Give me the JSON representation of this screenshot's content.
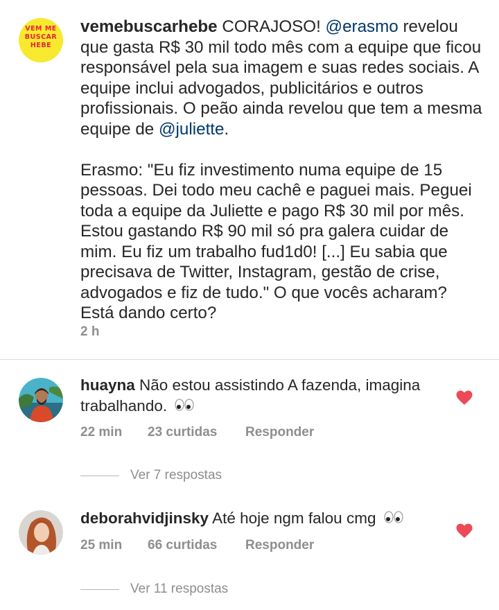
{
  "post": {
    "username": "vemebuscarhebe",
    "logo_text": "VEM ME BUSCAR HEBE",
    "text_part1": " CORAJOSO! ",
    "mention1": "@erasmo",
    "text_part2": " revelou que gasta R$ 30 mil todo mês com a equipe que ficou responsável pela sua imagem e suas redes sociais. A equipe inclui advogados, publicitários e outros profissionais. O peão ainda revelou que tem a mesma equipe de ",
    "mention2": "@juliette",
    "text_part3": ".\n\nErasmo: \"Eu fiz investimento numa equipe de 15 pessoas. Dei todo meu cachê e paguei mais. Peguei toda a equipe da Juliette e pago R$ 30 mil por mês. Estou gastando R$ 90 mil só pra galera cuidar de mim. Eu fiz um trabalho fud1d0! [...] Eu sabia que precisava de Twitter, Instagram, gestão de crise, advogados e fiz de tudo.\" O que vocês acharam? Está dando certo?",
    "time": "2 h"
  },
  "comments": [
    {
      "username": "huayna",
      "text": " Não estou assistindo A fazenda, imagina trabalhando. ",
      "emoji": "eyes",
      "time": "22 min",
      "likes": "23 curtidas",
      "reply": "Responder",
      "view_replies": "Ver 7 respostas",
      "liked": true
    },
    {
      "username": "deborahvidjinsky",
      "text": " Até hoje ngm falou cmg ",
      "emoji": "eyes",
      "time": "25 min",
      "likes": "66 curtidas",
      "reply": "Responder",
      "view_replies": "Ver 11 respostas",
      "liked": true
    }
  ],
  "colors": {
    "heart": "#ed4956",
    "mention": "#00376b",
    "meta": "#8e8e8e",
    "logo_bg": "#f7e92e",
    "logo_fg": "#e8213a"
  }
}
